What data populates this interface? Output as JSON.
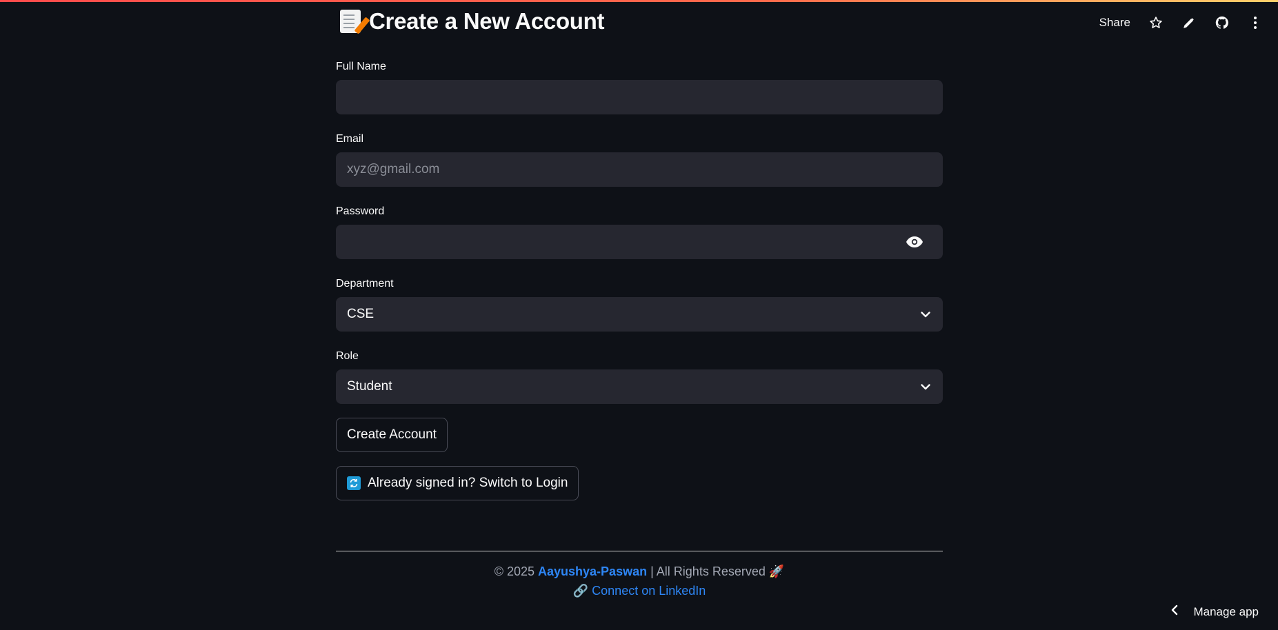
{
  "header": {
    "share_label": "Share",
    "icons": [
      "star-icon",
      "pencil-icon",
      "github-icon",
      "more-vertical-icon"
    ]
  },
  "page": {
    "title": "Create a New Account",
    "title_icon": "memo-emoji-icon"
  },
  "form": {
    "full_name": {
      "label": "Full Name",
      "value": "",
      "placeholder": ""
    },
    "email": {
      "label": "Email",
      "value": "",
      "placeholder": "xyz@gmail.com"
    },
    "password": {
      "label": "Password",
      "value": "",
      "placeholder": ""
    },
    "department": {
      "label": "Department",
      "selected": "CSE"
    },
    "role": {
      "label": "Role",
      "selected": "Student"
    },
    "create_button": "Create Account",
    "switch_button": "Already signed in? Switch to Login"
  },
  "footer": {
    "copyright": "© 2025",
    "author": "Aayushya-Paswan",
    "rights": "| All Rights Reserved",
    "rights_emoji": "🚀",
    "link_emoji": "🔗",
    "linkedin_label": "Connect on LinkedIn"
  },
  "manage_app_label": "Manage app",
  "colors": {
    "background": "#0e1117",
    "input_bg": "#262730",
    "link": "#2e86f5",
    "accent_stripe": "#ff4b4b"
  }
}
